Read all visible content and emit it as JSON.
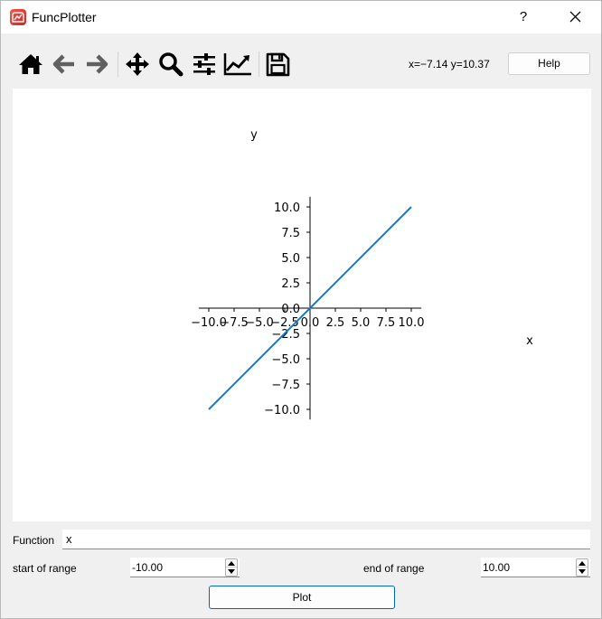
{
  "window": {
    "title": "FuncPlotter",
    "help_glyph": "?",
    "close_icon": "close-icon"
  },
  "toolbar": {
    "icons": [
      "home-icon",
      "back-arrow-icon",
      "forward-arrow-icon",
      "pan-icon",
      "zoom-icon",
      "configure-subplots-icon",
      "edit-axis-icon",
      "save-icon"
    ],
    "coords": "x=−7.14 y=10.37",
    "help_label": "Help"
  },
  "chart_data": {
    "type": "line",
    "xlabel": "x",
    "ylabel": "y",
    "xlim": [
      -11.0,
      11.0
    ],
    "ylim": [
      -11.0,
      11.0
    ],
    "spines": "centered at origin",
    "grid": false,
    "xticks": [
      -10.0,
      -7.5,
      -5.0,
      -2.5,
      0.0,
      2.5,
      5.0,
      7.5,
      10.0
    ],
    "yticks": [
      -10.0,
      -7.5,
      -5.0,
      -2.5,
      0.0,
      2.5,
      5.0,
      7.5,
      10.0
    ],
    "xtick_labels": [
      "−10.0",
      "−7.5",
      "−5.0",
      "−2.5",
      "0.0",
      "2.5",
      "5.0",
      "7.5",
      "10.0"
    ],
    "ytick_labels": [
      "−10.0",
      "−7.5",
      "−5.0",
      "−2.5",
      "0.0",
      "2.5",
      "5.0",
      "7.5",
      "10.0"
    ],
    "series": [
      {
        "color": "#1f77b4",
        "x": [
          -10.0,
          10.0
        ],
        "y": [
          -10.0,
          10.0
        ]
      }
    ]
  },
  "controls": {
    "function_label": "Function",
    "function_value": "x",
    "start_label": "start of range",
    "start_value": "-10.00",
    "end_label": "end of range",
    "end_value": "10.00",
    "plot_label": "Plot"
  }
}
